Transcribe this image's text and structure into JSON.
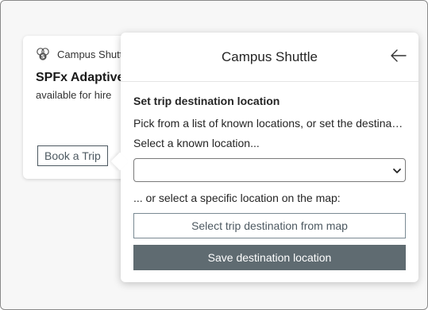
{
  "card": {
    "app_icon": "adaptive-card-extension-icon",
    "app_name": "Campus Shuttle",
    "title": "SPFx Adaptive",
    "subtitle": "available for hire",
    "book_label": "Book a Trip"
  },
  "popover": {
    "title": "Campus Shuttle",
    "back_icon": "arrow-left-icon",
    "section_title": "Set trip destination location",
    "description": "Pick from a list of known locations, or set the destination on the map.",
    "known_location_label": "Select a known location...",
    "select_value": "",
    "map_label": "... or select a specific location on the map:",
    "map_button_label": "Select trip destination from map",
    "save_button_label": "Save destination location"
  },
  "colors": {
    "accent": "#4d5961",
    "save_bg": "#5f6b71",
    "frame_bg": "#f7f7f7"
  }
}
